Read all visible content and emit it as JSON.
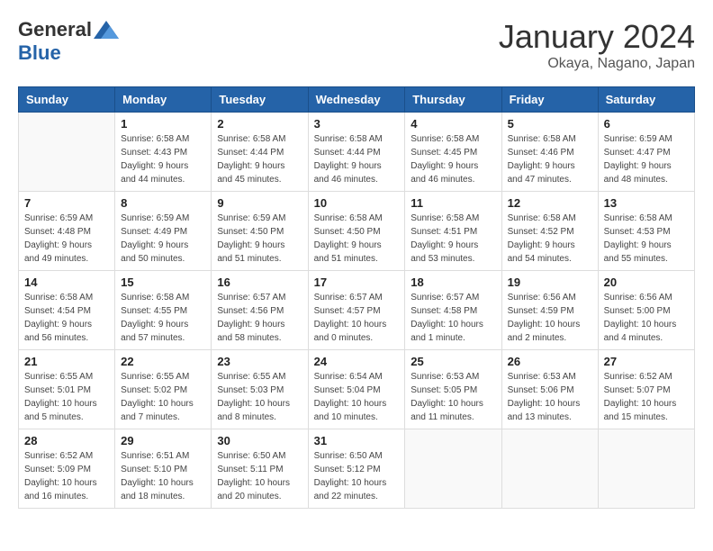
{
  "header": {
    "logo": {
      "general": "General",
      "blue": "Blue"
    },
    "title": "January 2024",
    "location": "Okaya, Nagano, Japan"
  },
  "weekdays": [
    "Sunday",
    "Monday",
    "Tuesday",
    "Wednesday",
    "Thursday",
    "Friday",
    "Saturday"
  ],
  "weeks": [
    [
      {
        "day": null,
        "info": null
      },
      {
        "day": "1",
        "info": "Sunrise: 6:58 AM\nSunset: 4:43 PM\nDaylight: 9 hours\nand 44 minutes."
      },
      {
        "day": "2",
        "info": "Sunrise: 6:58 AM\nSunset: 4:44 PM\nDaylight: 9 hours\nand 45 minutes."
      },
      {
        "day": "3",
        "info": "Sunrise: 6:58 AM\nSunset: 4:44 PM\nDaylight: 9 hours\nand 46 minutes."
      },
      {
        "day": "4",
        "info": "Sunrise: 6:58 AM\nSunset: 4:45 PM\nDaylight: 9 hours\nand 46 minutes."
      },
      {
        "day": "5",
        "info": "Sunrise: 6:58 AM\nSunset: 4:46 PM\nDaylight: 9 hours\nand 47 minutes."
      },
      {
        "day": "6",
        "info": "Sunrise: 6:59 AM\nSunset: 4:47 PM\nDaylight: 9 hours\nand 48 minutes."
      }
    ],
    [
      {
        "day": "7",
        "info": "Sunrise: 6:59 AM\nSunset: 4:48 PM\nDaylight: 9 hours\nand 49 minutes."
      },
      {
        "day": "8",
        "info": "Sunrise: 6:59 AM\nSunset: 4:49 PM\nDaylight: 9 hours\nand 50 minutes."
      },
      {
        "day": "9",
        "info": "Sunrise: 6:59 AM\nSunset: 4:50 PM\nDaylight: 9 hours\nand 51 minutes."
      },
      {
        "day": "10",
        "info": "Sunrise: 6:58 AM\nSunset: 4:50 PM\nDaylight: 9 hours\nand 51 minutes."
      },
      {
        "day": "11",
        "info": "Sunrise: 6:58 AM\nSunset: 4:51 PM\nDaylight: 9 hours\nand 53 minutes."
      },
      {
        "day": "12",
        "info": "Sunrise: 6:58 AM\nSunset: 4:52 PM\nDaylight: 9 hours\nand 54 minutes."
      },
      {
        "day": "13",
        "info": "Sunrise: 6:58 AM\nSunset: 4:53 PM\nDaylight: 9 hours\nand 55 minutes."
      }
    ],
    [
      {
        "day": "14",
        "info": "Sunrise: 6:58 AM\nSunset: 4:54 PM\nDaylight: 9 hours\nand 56 minutes."
      },
      {
        "day": "15",
        "info": "Sunrise: 6:58 AM\nSunset: 4:55 PM\nDaylight: 9 hours\nand 57 minutes."
      },
      {
        "day": "16",
        "info": "Sunrise: 6:57 AM\nSunset: 4:56 PM\nDaylight: 9 hours\nand 58 minutes."
      },
      {
        "day": "17",
        "info": "Sunrise: 6:57 AM\nSunset: 4:57 PM\nDaylight: 10 hours\nand 0 minutes."
      },
      {
        "day": "18",
        "info": "Sunrise: 6:57 AM\nSunset: 4:58 PM\nDaylight: 10 hours\nand 1 minute."
      },
      {
        "day": "19",
        "info": "Sunrise: 6:56 AM\nSunset: 4:59 PM\nDaylight: 10 hours\nand 2 minutes."
      },
      {
        "day": "20",
        "info": "Sunrise: 6:56 AM\nSunset: 5:00 PM\nDaylight: 10 hours\nand 4 minutes."
      }
    ],
    [
      {
        "day": "21",
        "info": "Sunrise: 6:55 AM\nSunset: 5:01 PM\nDaylight: 10 hours\nand 5 minutes."
      },
      {
        "day": "22",
        "info": "Sunrise: 6:55 AM\nSunset: 5:02 PM\nDaylight: 10 hours\nand 7 minutes."
      },
      {
        "day": "23",
        "info": "Sunrise: 6:55 AM\nSunset: 5:03 PM\nDaylight: 10 hours\nand 8 minutes."
      },
      {
        "day": "24",
        "info": "Sunrise: 6:54 AM\nSunset: 5:04 PM\nDaylight: 10 hours\nand 10 minutes."
      },
      {
        "day": "25",
        "info": "Sunrise: 6:53 AM\nSunset: 5:05 PM\nDaylight: 10 hours\nand 11 minutes."
      },
      {
        "day": "26",
        "info": "Sunrise: 6:53 AM\nSunset: 5:06 PM\nDaylight: 10 hours\nand 13 minutes."
      },
      {
        "day": "27",
        "info": "Sunrise: 6:52 AM\nSunset: 5:07 PM\nDaylight: 10 hours\nand 15 minutes."
      }
    ],
    [
      {
        "day": "28",
        "info": "Sunrise: 6:52 AM\nSunset: 5:09 PM\nDaylight: 10 hours\nand 16 minutes."
      },
      {
        "day": "29",
        "info": "Sunrise: 6:51 AM\nSunset: 5:10 PM\nDaylight: 10 hours\nand 18 minutes."
      },
      {
        "day": "30",
        "info": "Sunrise: 6:50 AM\nSunset: 5:11 PM\nDaylight: 10 hours\nand 20 minutes."
      },
      {
        "day": "31",
        "info": "Sunrise: 6:50 AM\nSunset: 5:12 PM\nDaylight: 10 hours\nand 22 minutes."
      },
      {
        "day": null,
        "info": null
      },
      {
        "day": null,
        "info": null
      },
      {
        "day": null,
        "info": null
      }
    ]
  ]
}
